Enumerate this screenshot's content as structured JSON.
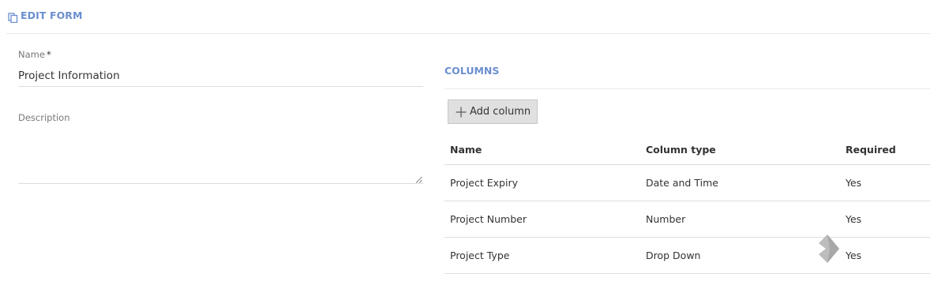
{
  "header": {
    "title": "EDIT FORM",
    "icon": "copy-icon",
    "accent_color": "#6b8fcf"
  },
  "form": {
    "name": {
      "label": "Name",
      "required_marker": "*",
      "value": "Project Information"
    },
    "description": {
      "label": "Description",
      "value": ""
    }
  },
  "columns": {
    "title": "COLUMNS",
    "add_button": {
      "label": "Add column",
      "icon": "plus-icon"
    },
    "table": {
      "headers": {
        "name": "Name",
        "type": "Column type",
        "required": "Required"
      },
      "rows": [
        {
          "name": "Project Expiry",
          "type": "Date and Time",
          "required": "Yes"
        },
        {
          "name": "Project Number",
          "type": "Number",
          "required": "Yes"
        },
        {
          "name": "Project Type",
          "type": "Drop Down",
          "required": "Yes"
        }
      ]
    }
  }
}
